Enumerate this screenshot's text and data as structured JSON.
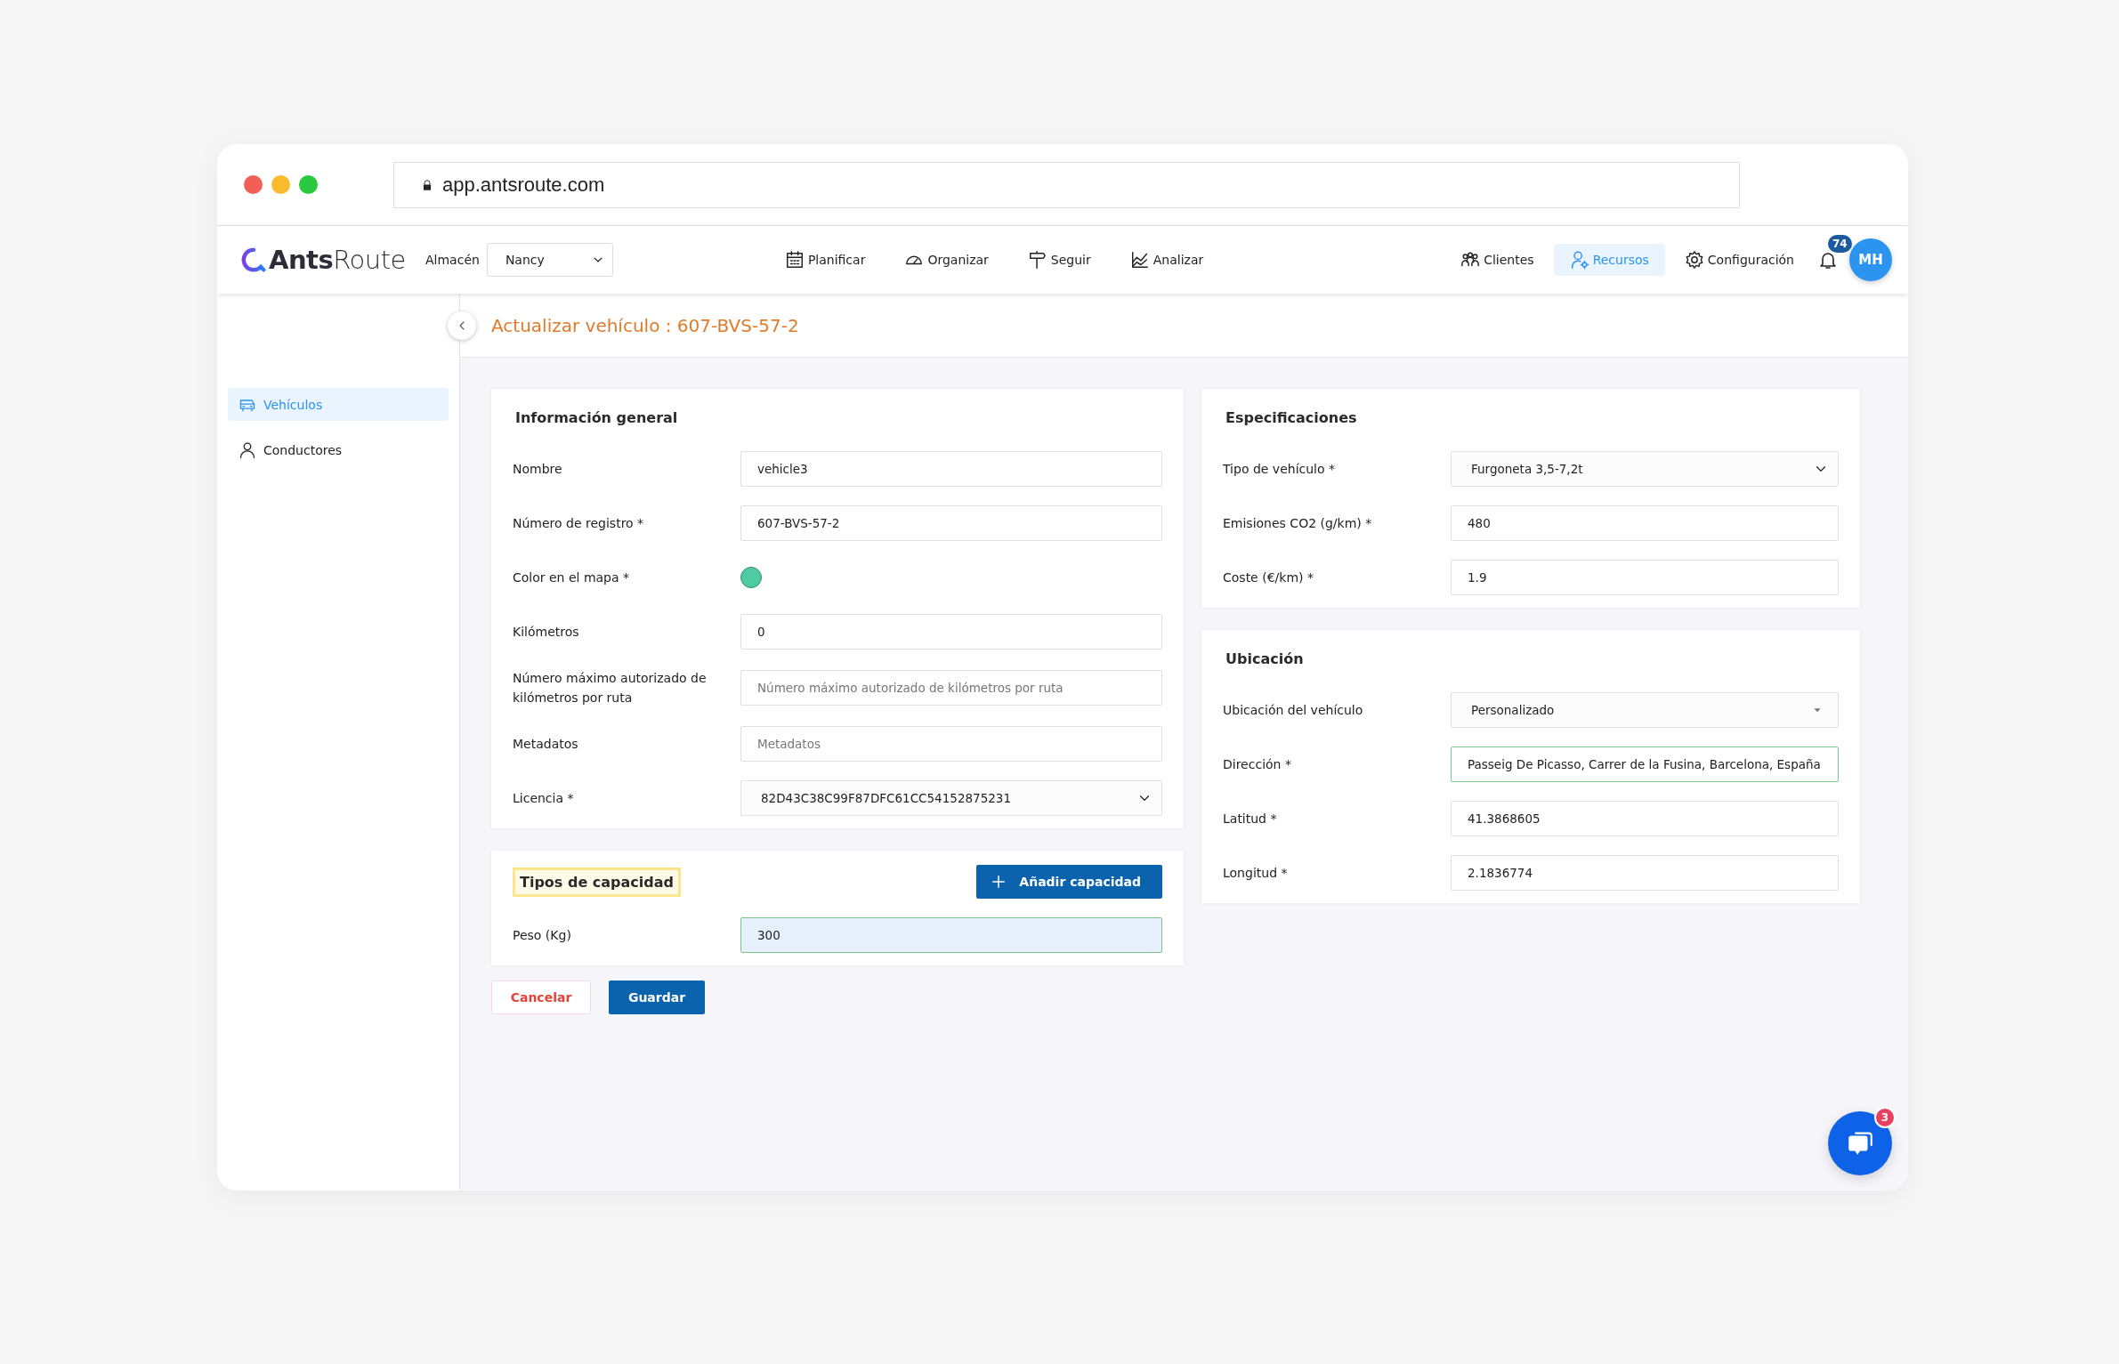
{
  "browser": {
    "url": "app.antsroute.com"
  },
  "header": {
    "logo": "**Ants**Route",
    "warehouse": {
      "label": "Almacén",
      "value": "Nancy"
    },
    "nav": [
      {
        "label": "Planificar",
        "selected": false
      },
      {
        "label": "Organizar",
        "selected": false
      },
      {
        "label": "Seguir",
        "selected": false
      },
      {
        "label": "Analizar",
        "selected": false
      }
    ],
    "nav_right": [
      {
        "label": "Clientes",
        "selected": false
      },
      {
        "label": "Recursos",
        "selected": true
      },
      {
        "label": "Configuración",
        "selected": false
      }
    ],
    "notifications": {
      "count": "74"
    },
    "avatar": {
      "initials": "MH"
    }
  },
  "sidebar": {
    "items": [
      {
        "label": "Vehículos",
        "selected": true
      },
      {
        "label": "Conductores",
        "selected": false
      }
    ]
  },
  "page_title": "Actualizar vehículo : 607-BVS-57-2",
  "left_column": [
    {
      "title": "Información general",
      "title_highlighted": false,
      "fields": [
        {
          "label": "Nombre",
          "kind": "text",
          "value": "vehicle3",
          "valid": false,
          "autofilled": false
        },
        {
          "label": "Número de registro *",
          "kind": "text",
          "value": "607-BVS-57-2",
          "valid": false,
          "autofilled": false
        },
        {
          "label": "Color en el mapa *",
          "kind": "color",
          "color": "#4fcba4",
          "valid": false,
          "autofilled": false
        },
        {
          "label": "Kilómetros",
          "kind": "text",
          "value": "0",
          "valid": false,
          "autofilled": false
        },
        {
          "label": "Número máximo autorizado de kilómetros por ruta",
          "kind": "text",
          "placeholder": "Número máximo autorizado de kilómetros por ruta",
          "valid": false,
          "autofilled": false
        },
        {
          "label": "Metadatos",
          "kind": "text",
          "placeholder": "Metadatos",
          "valid": false,
          "autofilled": false
        },
        {
          "label": "Licencia *",
          "kind": "select",
          "value": "82D43C38C99F87DFC61CC54152875231",
          "valid": false,
          "autofilled": false
        }
      ]
    },
    {
      "title": "Tipos de capacidad",
      "title_highlighted": true,
      "action": "Añadir capacidad",
      "fields": [
        {
          "label": "Peso (Kg)",
          "kind": "text",
          "value": "300",
          "valid": true,
          "autofilled": true
        }
      ]
    }
  ],
  "right_column": [
    {
      "title": "Especificaciones",
      "title_highlighted": false,
      "fields": [
        {
          "label": "Tipo de vehículo *",
          "kind": "select",
          "value": "Furgoneta 3,5-7,2t",
          "valid": false,
          "autofilled": false
        },
        {
          "label": "Emisiones CO2 (g/km) *",
          "kind": "text",
          "value": "480",
          "valid": false,
          "autofilled": false
        },
        {
          "label": "Coste (€/km) *",
          "kind": "text",
          "value": "1.9",
          "valid": false,
          "autofilled": false
        }
      ]
    },
    {
      "title": "Ubicación",
      "title_highlighted": false,
      "fields": [
        {
          "label": "Ubicación del vehículo",
          "kind": "dropdown",
          "value": "Personalizado",
          "valid": false,
          "autofilled": false
        },
        {
          "label": "Dirección *",
          "kind": "text",
          "value": "Passeig De Picasso, Carrer de la Fusina, Barcelona, España",
          "valid": true,
          "autofilled": false
        },
        {
          "label": "Latitud *",
          "kind": "text",
          "value": "41.3868605",
          "valid": false,
          "autofilled": false
        },
        {
          "label": "Longitud *",
          "kind": "text",
          "value": "2.1836774",
          "valid": false,
          "autofilled": false
        }
      ]
    }
  ],
  "actions": [
    {
      "label": "Cancelar",
      "kind": "secondary"
    },
    {
      "label": "Guardar",
      "kind": "primary"
    }
  ],
  "chat": {
    "badge": "3"
  }
}
